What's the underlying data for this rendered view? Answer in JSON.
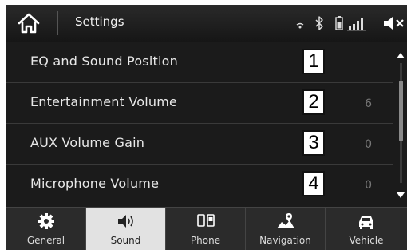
{
  "header": {
    "title": "Settings",
    "icons": [
      "home-icon",
      "wifi-icon",
      "bluetooth-icon",
      "battery-icon",
      "signal-icon",
      "mute-icon"
    ]
  },
  "rows": [
    {
      "label": "EQ and Sound Position",
      "value": "",
      "callout": "1"
    },
    {
      "label": "Entertainment Volume",
      "value": "6",
      "callout": "2"
    },
    {
      "label": "AUX Volume Gain",
      "value": "0",
      "callout": "3"
    },
    {
      "label": "Microphone Volume",
      "value": "0",
      "callout": "4"
    }
  ],
  "tabs": [
    {
      "label": "General",
      "icon": "gear-icon"
    },
    {
      "label": "Sound",
      "icon": "speaker-icon",
      "active": true
    },
    {
      "label": "Phone",
      "icon": "phone-icon"
    },
    {
      "label": "Navigation",
      "icon": "navigation-icon"
    },
    {
      "label": "Vehicle",
      "icon": "car-icon"
    }
  ],
  "colors": {
    "background": "#1b1b1b",
    "active_tab": "#e2e2e2",
    "callout_bg": "#ffffff"
  }
}
